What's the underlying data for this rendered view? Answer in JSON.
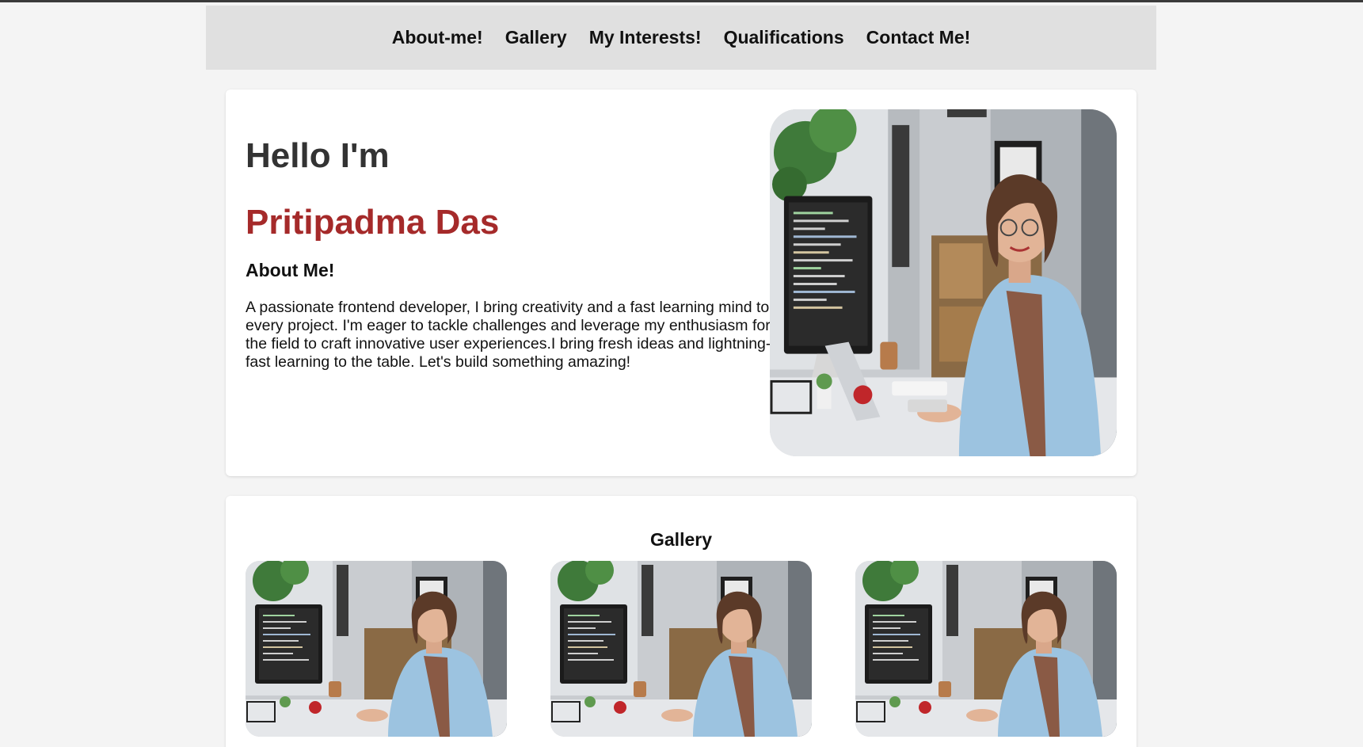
{
  "nav": {
    "items": [
      "About-me!",
      "Gallery",
      "My Interests!",
      "Qualifications",
      "Contact Me!"
    ]
  },
  "hero": {
    "greeting": "Hello I'm",
    "name": "Pritipadma Das",
    "about_title": "About Me!",
    "about_text": "A passionate frontend developer, I bring creativity and a fast learning mind to every project. I'm eager to tackle challenges and leverage my enthusiasm for the field to craft innovative user experiences.I bring fresh ideas and lightning-fast learning to the table. Let's build something amazing!"
  },
  "gallery": {
    "title": "Gallery",
    "image_count": 3
  },
  "colors": {
    "name_accent": "#a52a2a",
    "nav_background": "#e0e0e0",
    "page_background": "#f4f4f4"
  }
}
